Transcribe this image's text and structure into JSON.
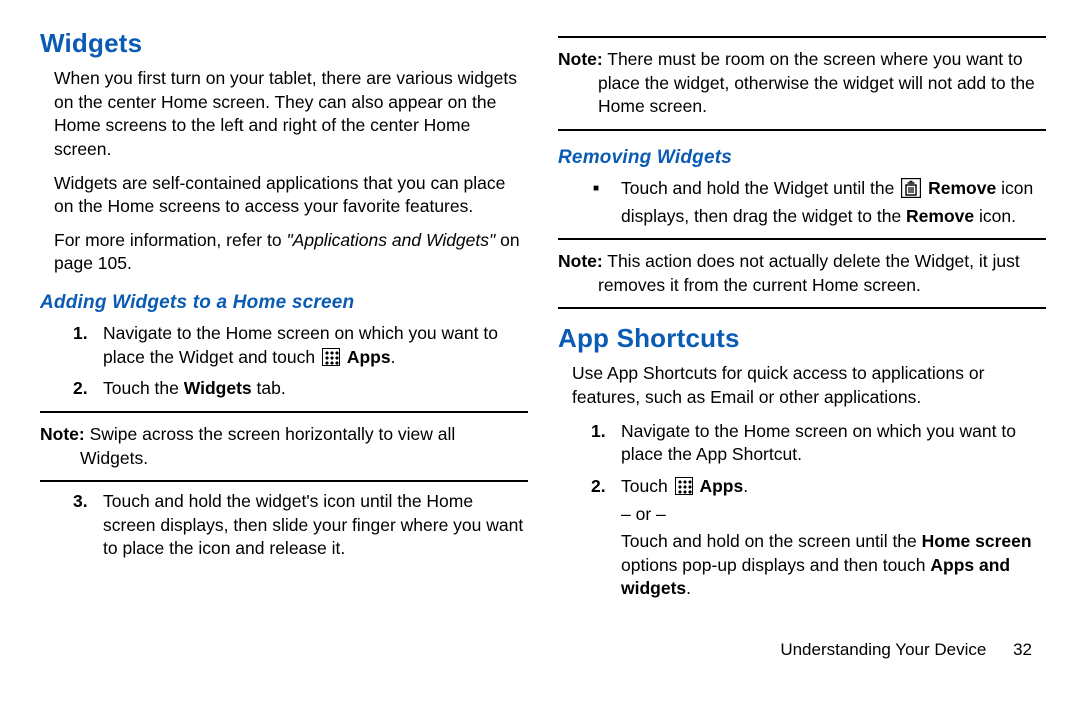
{
  "left": {
    "h1": "Widgets",
    "p1": "When you first turn on your tablet, there are various widgets on the center Home screen. They can also appear on the Home screens to the left and right of the center Home screen.",
    "p2": "Widgets are self-contained applications that you can place on the Home screens to access your favorite features.",
    "p3a": "For more information, refer to ",
    "p3b": "\"Applications and Widgets\"",
    "p3c": " on page 105.",
    "h2": "Adding Widgets to a Home screen",
    "s1a": "Navigate to the Home screen on which you want to place the Widget and touch ",
    "s1b": "Apps",
    "s1c": ".",
    "s2a": "Touch the ",
    "s2b": "Widgets",
    "s2c": " tab.",
    "note1_label": "Note:",
    "note1": " Swipe across the screen horizontally to view all Widgets.",
    "s3": "Touch and hold the widget's icon until the Home screen displays, then slide your finger where you want to place the icon and release it."
  },
  "right": {
    "note1_label": "Note:",
    "note1": " There must be room on the screen where you want to place the widget, otherwise the widget will not add to the Home screen.",
    "h2a": "Removing Widgets",
    "b1a": "Touch and hold the Widget until the ",
    "b1b": "Remove",
    "b1c": " icon displays, then drag the widget to the ",
    "b1d": "Remove",
    "b1e": " icon.",
    "note2_label": "Note:",
    "note2": " This action does not actually delete the Widget, it just removes it from the current Home screen.",
    "h1b": "App Shortcuts",
    "p1": "Use App Shortcuts for quick access to applications or features, such as Email or other applications.",
    "s1": "Navigate to the Home screen on which you want to place the App Shortcut.",
    "s2a": "Touch ",
    "s2b": "Apps",
    "s2c": ".",
    "s2d": "– or –",
    "s2e": "Touch and hold on the screen until the ",
    "s2f": "Home screen",
    "s2g": " options pop-up displays and then touch ",
    "s2h": "Apps and widgets",
    "s2i": "."
  },
  "footer": {
    "chapter": "Understanding Your Device",
    "page": "32"
  }
}
